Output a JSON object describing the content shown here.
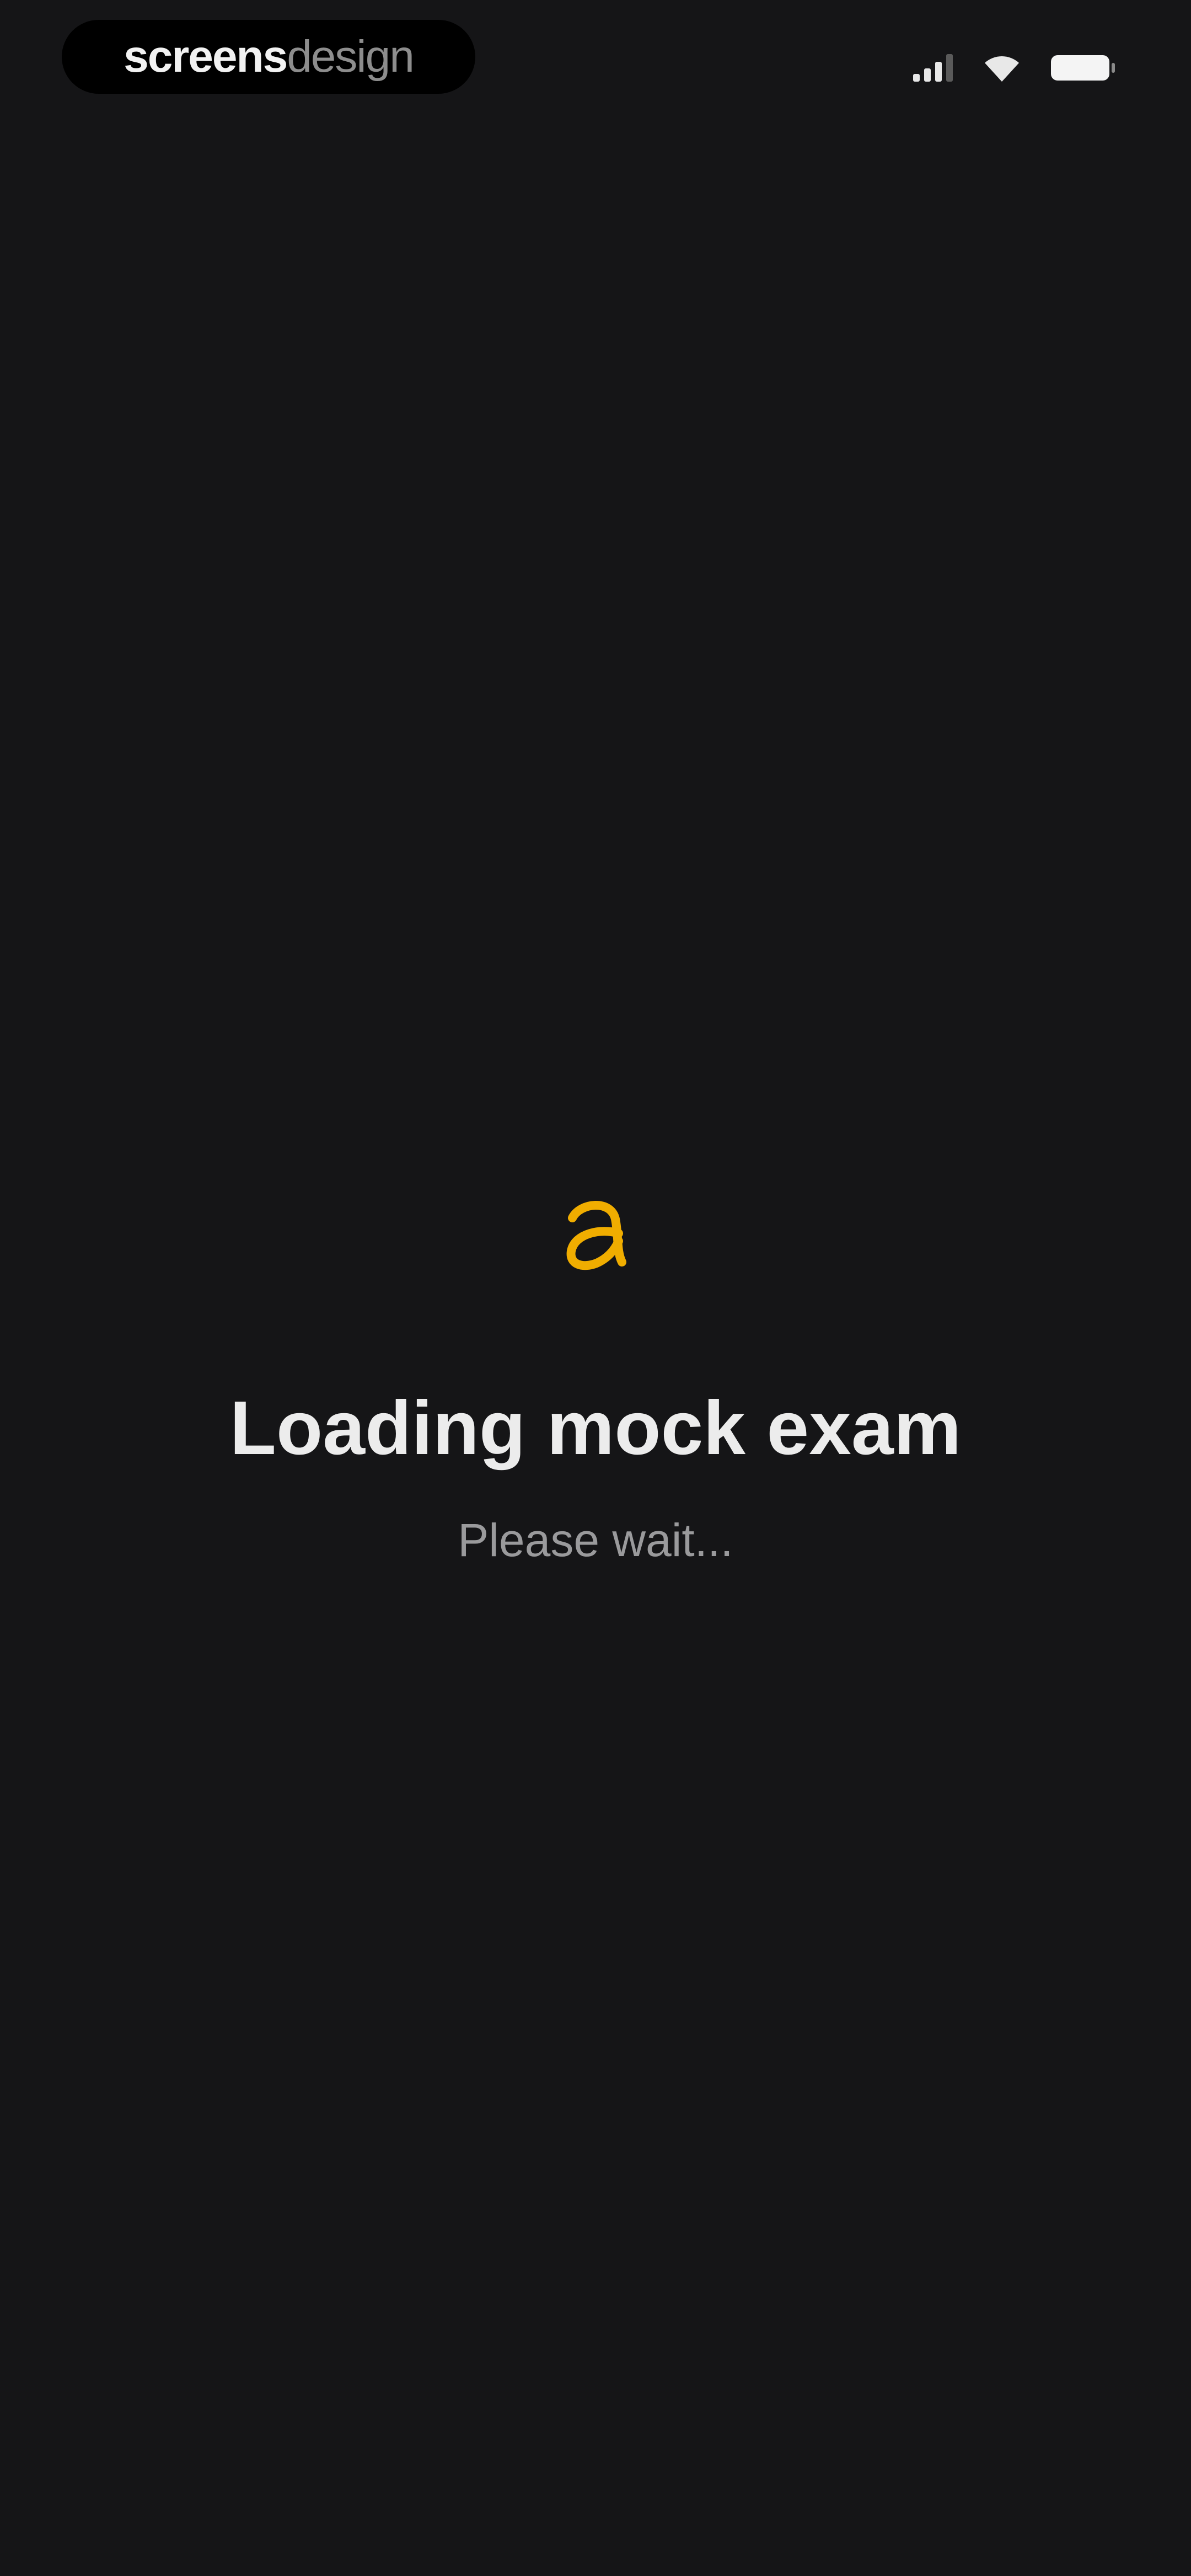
{
  "status_bar": {
    "watermark_primary": "screens",
    "watermark_secondary": "design",
    "icons": [
      "cellular-signal-icon",
      "wifi-icon",
      "battery-icon"
    ]
  },
  "loading": {
    "logo_icon": "app-logo-icon",
    "accent_color": "#f0ad00",
    "title": "Loading mock exam",
    "subtitle": "Please wait..."
  },
  "colors": {
    "background": "#151517",
    "title_text": "#ececec",
    "subtitle_text": "#9a9a9c"
  }
}
